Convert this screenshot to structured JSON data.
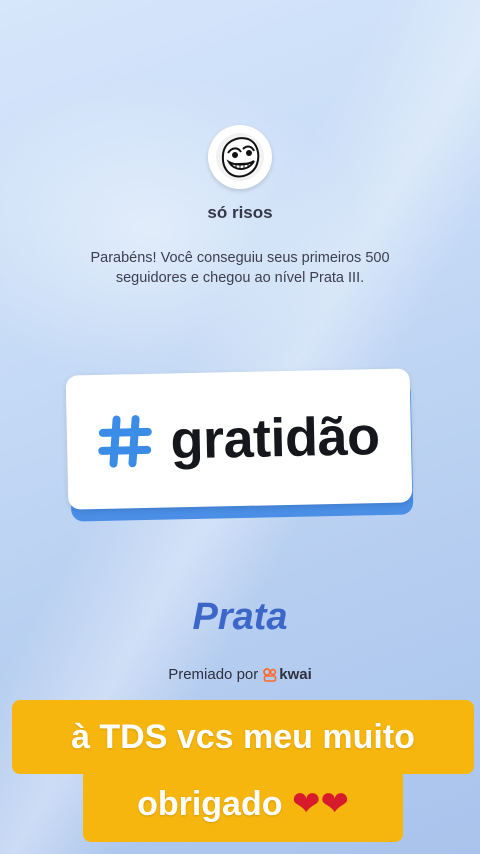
{
  "profile": {
    "avatar_icon": "troll-face-icon",
    "username": "só risos"
  },
  "message": {
    "line1": "Parabéns! Você conseguiu seus primeiros 500",
    "line2": "seguidores e chegou ao nível Prata III."
  },
  "badge": {
    "icon": "hashtag-icon",
    "text": "gratidão",
    "accent_color": "#3b8ce6"
  },
  "level": {
    "name": "Prata",
    "color": "#3c67c9"
  },
  "awarded": {
    "label": "Premiado por",
    "brand": "kwai",
    "brand_color": "#ff6a2b"
  },
  "caption": {
    "line1": "à TDS vcs meu muito",
    "line2_text": "obrigado",
    "hearts": "❤❤",
    "background": "#f7b60d"
  }
}
